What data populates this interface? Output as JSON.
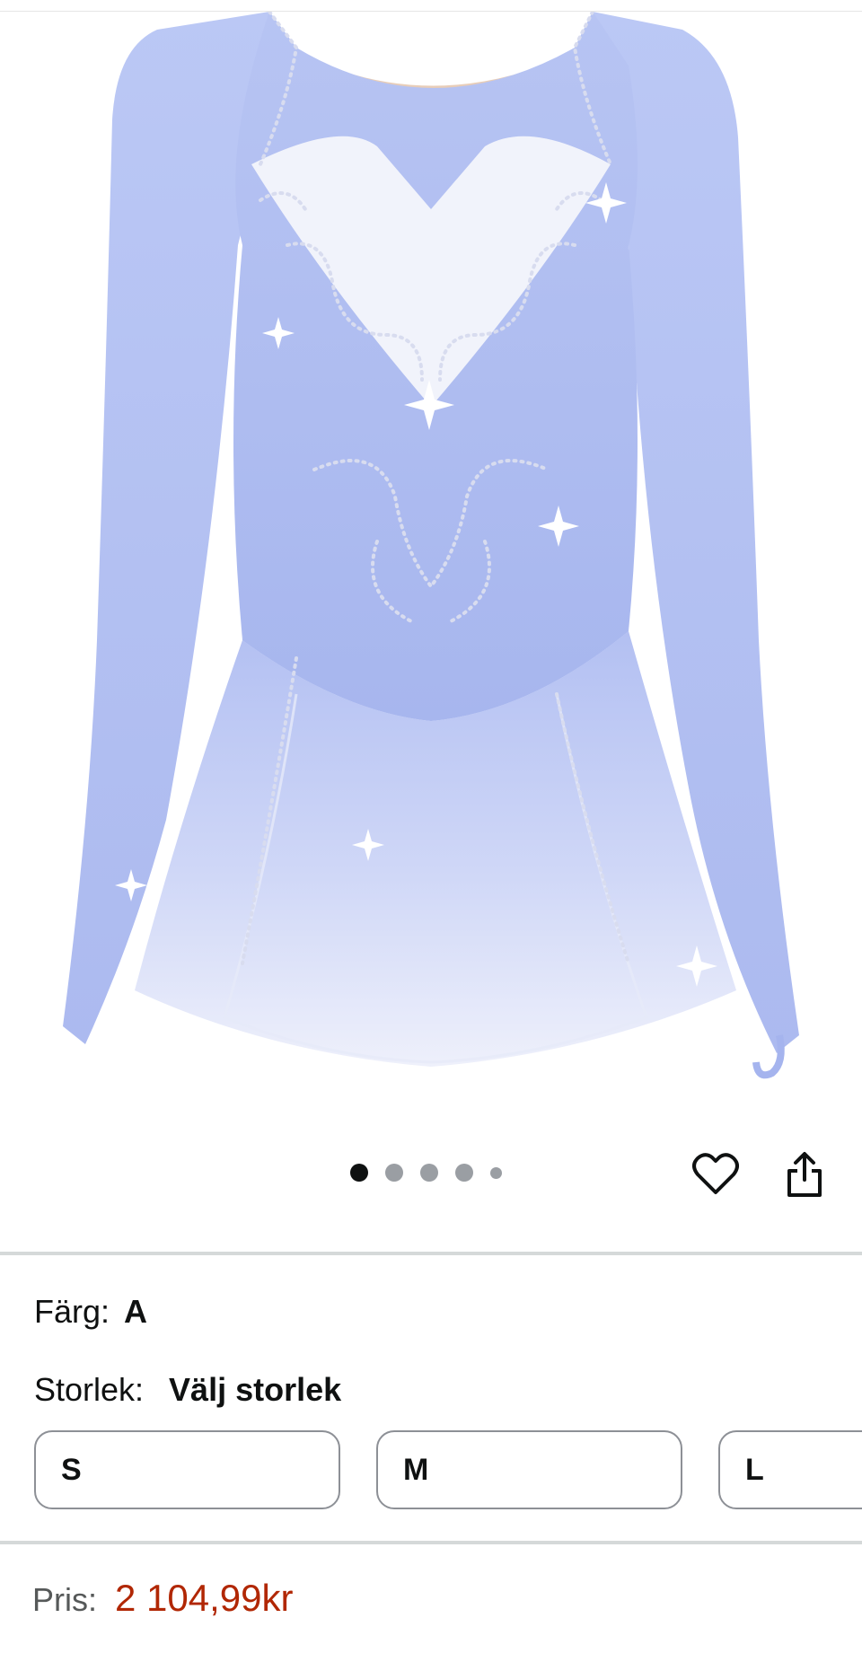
{
  "product": {
    "image_description": "",
    "gallery": {
      "total_images": 5,
      "active_index": 0
    }
  },
  "actions": {
    "wishlist_icon": "heart-icon",
    "share_icon": "share-icon"
  },
  "color": {
    "label": "Färg:",
    "value": "A"
  },
  "size": {
    "label": "Storlek:",
    "value": "Välj storlek",
    "options": [
      "S",
      "M",
      "L"
    ]
  },
  "price": {
    "label": "Pris:",
    "value": "2 104,99kr"
  },
  "colors": {
    "price": "#b12704",
    "dress_blue": "#aab9f0",
    "divider": "#d5d9d9"
  }
}
